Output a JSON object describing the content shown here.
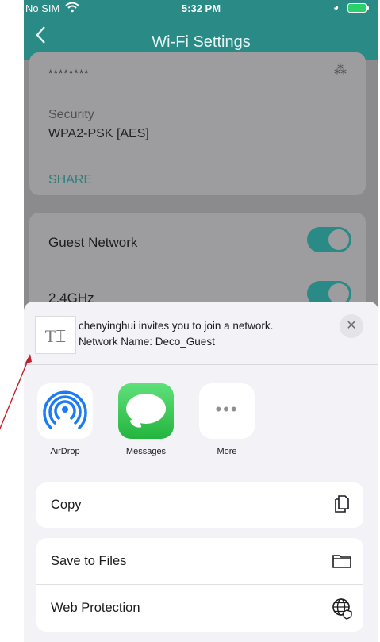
{
  "status_bar": {
    "carrier": "No SIM",
    "time": "5:32 PM",
    "wifi_icon": "wifi-icon",
    "battery_icon": "battery-charging-icon"
  },
  "nav": {
    "back_icon": "chevron-left-icon",
    "title": "Wi-Fi Settings"
  },
  "wifi_card": {
    "password_masked": "********",
    "security_label": "Security",
    "security_value": "WPA2-PSK [AES]",
    "share_label": "SHARE"
  },
  "guest_card": {
    "guest_network_label": "Guest Network",
    "guest_network_on": true,
    "band_label": "2.4GHz",
    "band_on": true
  },
  "share_sheet": {
    "message_line1": "chenyinghui invites you to join a network.",
    "message_line2": "Network Name: Deco_Guest",
    "thumb_glyph": "T⌶",
    "close_glyph": "✕",
    "apps": [
      {
        "label": "AirDrop",
        "icon": "airdrop-icon"
      },
      {
        "label": "Messages",
        "icon": "messages-icon"
      },
      {
        "label": "More",
        "icon": "more-icon"
      }
    ],
    "more_glyph": "•••",
    "actions": [
      {
        "label": "Copy",
        "icon": "copy-icon"
      },
      {
        "label": "Save to Files",
        "icon": "folder-icon"
      },
      {
        "label": "Web Protection",
        "icon": "globe-shield-icon"
      }
    ]
  },
  "colors": {
    "accent": "#2a8a86",
    "sheet_bg": "#f2f2f7",
    "annotation_arrow": "#c0202a"
  }
}
